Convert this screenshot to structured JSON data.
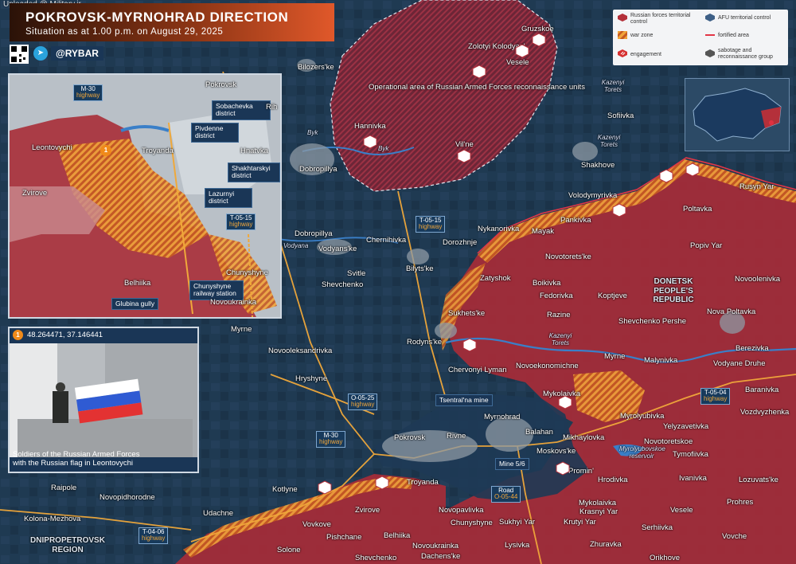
{
  "watermark": "Uploaded @ Military.ir",
  "header": {
    "title": "POKROVSK-MYRNOHRAD DIRECTION",
    "subtitle": "Situation as at 1.00 p.m. on August 29, 2025",
    "telegram_icon": "telegram-icon",
    "handle": "@RYBAR"
  },
  "legend": {
    "russian_forces": "Russian forces territorial control",
    "afu_control": "AFU territorial control",
    "war_zone": "war zone",
    "fortified_area": "fortified area",
    "engagement": "engagement",
    "sabotage": "sabotage and reconnaissance group"
  },
  "colors": {
    "russian_control": "#b4303a",
    "afu_control": "#1d3a55",
    "war_zone": "#e6932a",
    "fortified_line": "#e03040",
    "roads": "#f0a83a",
    "title_gradient_end": "#e0582a"
  },
  "map": {
    "operational_area": "Operational area of Russian Armed Forces reconnaissance units",
    "places": [
      {
        "name": "Gruzskoe"
      },
      {
        "name": "Zolotyi Kolodyaz'"
      },
      {
        "name": "Vesele"
      },
      {
        "name": "Bilozers'ke"
      },
      {
        "name": "Hannivka"
      },
      {
        "name": "Vil'ne"
      },
      {
        "name": "Dobropillya"
      },
      {
        "name": "Sofiivka"
      },
      {
        "name": "Shakhove"
      },
      {
        "name": "Volodymyrivka"
      },
      {
        "name": "Rusyn Yar"
      },
      {
        "name": "Poltavka"
      },
      {
        "name": "Pankivka"
      },
      {
        "name": "Nykanorivka"
      },
      {
        "name": "Mayak"
      },
      {
        "name": "Popiv Yar"
      },
      {
        "name": "Novotorets'ke"
      },
      {
        "name": "Dobropillya"
      },
      {
        "name": "Chernihivka"
      },
      {
        "name": "Dorozhnje"
      },
      {
        "name": "Vodyans'ke"
      },
      {
        "name": "Bilyts'ke"
      },
      {
        "name": "Svitle"
      },
      {
        "name": "Shevchenko"
      },
      {
        "name": "Zatyshok"
      },
      {
        "name": "Boikivka"
      },
      {
        "name": "Fedorivka"
      },
      {
        "name": "Koptjeve"
      },
      {
        "name": "Novoolenivka"
      },
      {
        "name": "Nova Poltavka"
      },
      {
        "name": "Razine"
      },
      {
        "name": "Sukhets'ke"
      },
      {
        "name": "Shevchenko Pershe"
      },
      {
        "name": "Berezivka"
      },
      {
        "name": "Myrne"
      },
      {
        "name": "Novooleksandrivka"
      },
      {
        "name": "Rodyns'ke"
      },
      {
        "name": "Chervonyi Lyman"
      },
      {
        "name": "Novoekonomichne"
      },
      {
        "name": "Myrne"
      },
      {
        "name": "Malynivka"
      },
      {
        "name": "Vodyane Druhe"
      },
      {
        "name": "Baranivka"
      },
      {
        "name": "Hryshyne"
      },
      {
        "name": "Mykolaivka"
      },
      {
        "name": "Myrolyubivka"
      },
      {
        "name": "Vozdvyzhenka"
      },
      {
        "name": "Yelyzavetivka"
      },
      {
        "name": "Myrnohrad"
      },
      {
        "name": "Pokrovsk"
      },
      {
        "name": "Rivne"
      },
      {
        "name": "Balahan"
      },
      {
        "name": "Mikhaylovka"
      },
      {
        "name": "Novotoretskoe"
      },
      {
        "name": "Moskovs'ke"
      },
      {
        "name": "Tymofiivka"
      },
      {
        "name": "Promin'"
      },
      {
        "name": "Hrodivka"
      },
      {
        "name": "Ivanivka"
      },
      {
        "name": "Lozuvats'ke"
      },
      {
        "name": "Raipole"
      },
      {
        "name": "Novopidhorodne"
      },
      {
        "name": "Kotlyne"
      },
      {
        "name": "Troyanda"
      },
      {
        "name": "Mykolaivka"
      },
      {
        "name": "Krasnyi Yar"
      },
      {
        "name": "Vesele"
      },
      {
        "name": "Prohres"
      },
      {
        "name": "Kolona-Mezhova"
      },
      {
        "name": "Udachne"
      },
      {
        "name": "Zvirove"
      },
      {
        "name": "Novopavlivka"
      },
      {
        "name": "Vovkove"
      },
      {
        "name": "Chunyshyne"
      },
      {
        "name": "Sukhyi Yar"
      },
      {
        "name": "Krutyi Yar"
      },
      {
        "name": "Serhiivka"
      },
      {
        "name": "Pishchane"
      },
      {
        "name": "Belhiika"
      },
      {
        "name": "Zhuravka"
      },
      {
        "name": "Vovche"
      },
      {
        "name": "Novoukrainka"
      },
      {
        "name": "Lysivka"
      },
      {
        "name": "Solone"
      },
      {
        "name": "Shevchenko"
      },
      {
        "name": "Dachens'ke"
      },
      {
        "name": "Orikhove"
      }
    ],
    "region_labels": {
      "donetsk": "DONETSK PEOPLE'S REPUBLIC",
      "dnipro": "DNIPROPETROVSK REGION"
    },
    "water_labels": {
      "byk1": "Byk",
      "byk2": "Byk",
      "vodyana": "Vodyana",
      "kazenyi1": "Kazenyi Torets",
      "kazenyi2": "Kazenyi Torets",
      "kazenyi3": "Kazenyi Torets",
      "reservoir": "Myrolyubovskoe reservoir"
    },
    "highways": {
      "m30a": {
        "code": "M-30",
        "word": "highway"
      },
      "m30b": {
        "code": "M-30",
        "word": "highway"
      },
      "t0515a": {
        "code": "T-05-15",
        "word": "highway"
      },
      "t0515b": {
        "code": "T-05-15",
        "word": "highway"
      },
      "o0525": {
        "code": "O-05-25",
        "word": "highway"
      },
      "t0504": {
        "code": "T-05-04",
        "word": "highway"
      },
      "t0406": {
        "code": "T-04-06",
        "word": "highway"
      },
      "road": {
        "code": "Road",
        "word": "O-05-44"
      }
    },
    "markers": {
      "mine": "Tsentral'na mine",
      "mine56": "Mine 5/6"
    }
  },
  "inset": {
    "places": {
      "pokrovsk": "Pokrovsk",
      "sobachevka": "Sobachevka district",
      "rih": "Rih",
      "leontovychi": "Leontovychi",
      "pivdenne": "Pivdenne district",
      "troyanda": "Troyanda",
      "hnativka": "Hnatvka",
      "shakhtarskyi": "Shakhtarskyi district",
      "lazurnyi": "Lazurnyi district",
      "zvirove": "Zvirove",
      "belhiika": "Belhiika",
      "chunyshyne": "Chunyshyne",
      "railway": "Chunyshyne railway station",
      "glubina": "Glubina gully",
      "novoukrainka": "Novoukrainka"
    },
    "highways": {
      "m30": {
        "code": "M-30",
        "word": "highway"
      },
      "t0515": {
        "code": "T-05-15",
        "word": "highway"
      }
    }
  },
  "photo": {
    "badge": "1",
    "coords": "48.264471, 37.146441",
    "caption_line1": "Soldiers of the Russian Armed Forces",
    "caption_line2": "with the Russian flag in Leontovychi"
  }
}
